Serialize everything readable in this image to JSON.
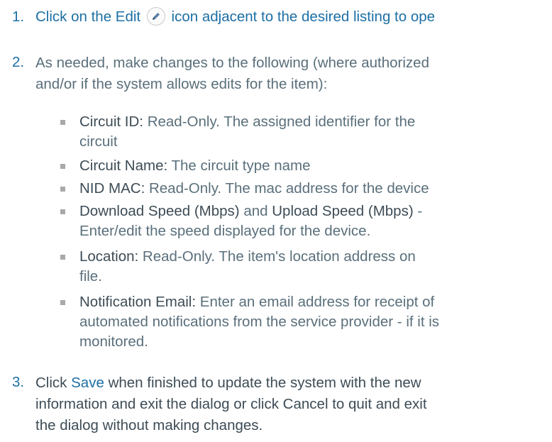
{
  "steps": [
    {
      "number": "1.",
      "before_icon": "Click on the Edit",
      "icon": "pencil-icon",
      "after_icon": "icon adjacent to the desired listing to ope"
    },
    {
      "number": "2.",
      "line1": "As needed, make changes to the following (where authorized",
      "line2": "and/or if the system allows edits for the item):"
    },
    {
      "number": "3.",
      "line1_pre": "Click",
      "line1_link": "Save",
      "line1_post": "when finished to update the system with the new",
      "line2": "information and exit the dialog or click Cancel to quit and exit",
      "line3": "the dialog without making changes."
    }
  ],
  "fields": [
    {
      "term": "Circuit ID",
      "sep": ":",
      "desc_line1": "Read-Only. The assigned identifier for the",
      "desc_line2": "circuit"
    },
    {
      "term": "Circuit Name",
      "sep": ":",
      "desc_line1": "The circuit type name"
    },
    {
      "term": "NID MAC",
      "sep": ":",
      "desc_line1": "Read-Only. The mac address for the device"
    },
    {
      "term": "Download Speed (Mbps)",
      "joiner": "and",
      "term2": "Upload Speed (Mbps)",
      "sep": "-",
      "desc_line2": "Enter/edit the speed displayed for the device."
    },
    {
      "term": "Location",
      "sep": ":",
      "desc_line1": "Read-Only. The item's location address on",
      "desc_line2": "file."
    },
    {
      "term": "Notification Email",
      "sep": ":",
      "desc_line1": "Enter an email address for receipt of",
      "desc_line2": "automated notifications from the service provider - if it is",
      "desc_line3": "monitored."
    }
  ],
  "colors": {
    "step_number": "#1d6fa5",
    "body_text": "#5a6f7b",
    "term_text": "#3d4c56",
    "bullet": "#a7a9ab"
  }
}
